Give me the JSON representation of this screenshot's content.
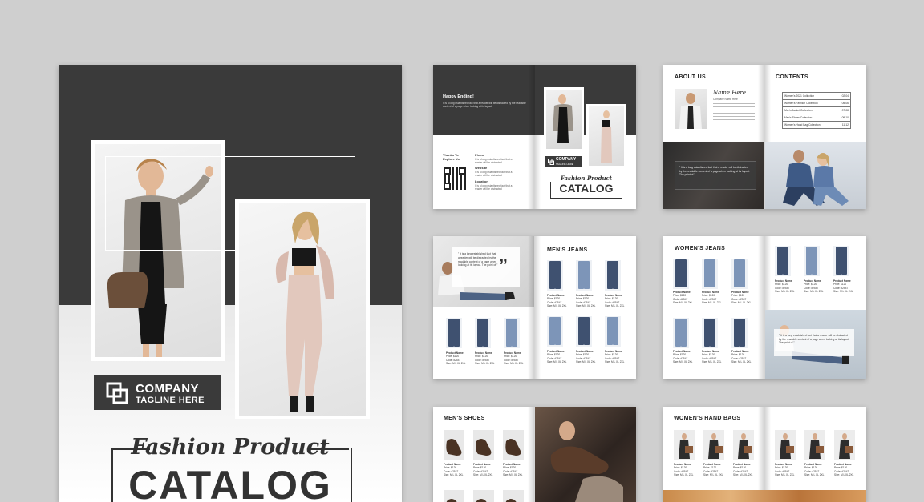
{
  "cover": {
    "company": "COMPANY",
    "tagline": "TAGLINE HERE",
    "script_title": "Fashion Product",
    "title": "CATALOG"
  },
  "spread_back": {
    "heading": "Happy Ending!",
    "body": "It is a long established fact that a reader will be distracted by the readable content of a page when looking at its layout.",
    "thanks": "Thanks To Explore Us",
    "phone_label": "Phone",
    "phone_text": "It is a long established fact that a reader will be distracted",
    "website_label": "Website",
    "website_text": "It is a long established fact that a reader will be distracted",
    "location_label": "Location",
    "location_text": "It is a long established fact that a reader will be distracted",
    "company": "COMPANY",
    "tagline": "TAGLINE HERE",
    "script_title": "Fashion Product",
    "title": "CATALOG"
  },
  "spread_about": {
    "about_heading": "ABOUT US",
    "signature": "Name Here",
    "about_text": "Company Name Here",
    "quote": "\" It is a long established fact that a reader will be distracted by the readable content of a page when looking at its layout. The point of \"",
    "contents_heading": "CONTENTS",
    "contents": [
      {
        "label": "Women's 2021 Collection",
        "page": "02-04"
      },
      {
        "label": "Women's Fashion Collection",
        "page": "05-06"
      },
      {
        "label": "Men's Jacket Collection",
        "page": "07-08"
      },
      {
        "label": "Men's Shoes Collection",
        "page": "09-10"
      },
      {
        "label": "Women's Hand Bag Collection",
        "page": "11-12"
      }
    ]
  },
  "spread_mens_jeans": {
    "quote": "\" It is a long established fact that a reader will be distracted by the readable content of a page when looking at its layout. The point of \"",
    "heading": "MEN'S JEANS",
    "item_name": "Product Name",
    "item_price": "Price: $120",
    "item_code": "Code: #2547",
    "item_size": "Size: M L XL 2XL"
  },
  "spread_womens_jeans": {
    "heading": "WOMEN'S JEANS",
    "quote": "\" It is a long established fact that a reader will be distracted by the readable content of a page when looking at its layout. The point of \"",
    "item_name": "Product Name",
    "item_price": "Price: $120",
    "item_code": "Code: #2547",
    "item_size": "Size: M L XL 2XL"
  },
  "spread_shoes": {
    "heading": "MEN'S SHOES",
    "item_name": "Product Name",
    "item_price": "Price: $120",
    "item_code": "Code: #2547",
    "item_size": "Size: M L XL 2XL"
  },
  "spread_bags": {
    "heading": "WOMEN'S HAND BAGS",
    "item_name": "Product Name",
    "item_price": "Price: $120",
    "item_code": "Code: #2547",
    "item_size": "Size: M L XL 2XL"
  },
  "colors": {
    "background": "#cfcfcf",
    "dark": "#3a3a3a",
    "denim_dark": "#3f5170",
    "denim_light": "#7d95b8"
  }
}
